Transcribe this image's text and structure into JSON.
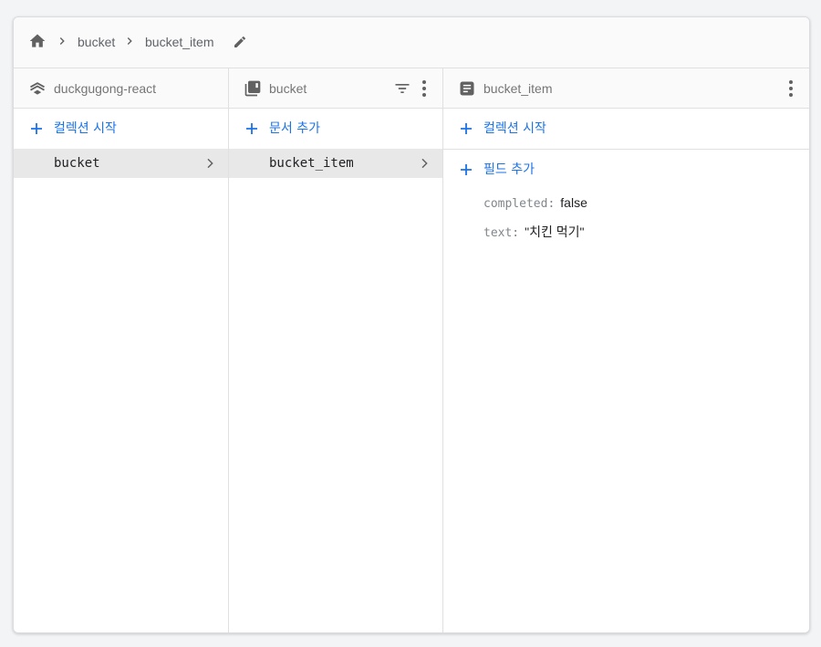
{
  "breadcrumb": {
    "items": [
      "bucket",
      "bucket_item"
    ]
  },
  "panels": {
    "root": {
      "title": "duckgugong-react",
      "add_label": "컬렉션 시작",
      "items": [
        {
          "label": "bucket"
        }
      ]
    },
    "collection": {
      "title": "bucket",
      "add_label": "문서 추가",
      "items": [
        {
          "label": "bucket_item"
        }
      ]
    },
    "document": {
      "title": "bucket_item",
      "add_collection_label": "컬렉션 시작",
      "add_field_label": "필드 추가",
      "fields": [
        {
          "key": "completed:",
          "value": "false"
        },
        {
          "key": "text:",
          "value": "\"치킨 먹기\""
        }
      ]
    }
  },
  "colors": {
    "accent": "#1a73e8",
    "selected_row": "#e8e8e8",
    "header_bg": "#fafafa"
  },
  "icons": {
    "home": "home-icon",
    "root": "layers-icon",
    "collection": "collection-icon",
    "document": "document-icon",
    "edit": "pencil-icon",
    "filter": "filter-icon",
    "more": "more-vert-icon",
    "add": "plus-icon",
    "chevron": "chevron-right-icon"
  }
}
